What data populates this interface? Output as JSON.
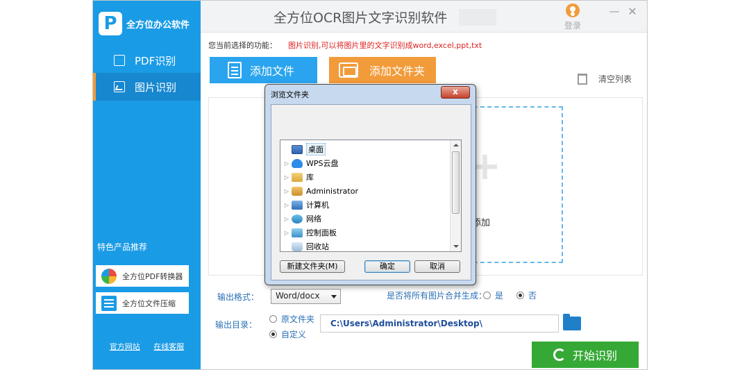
{
  "app": {
    "logo_letter": "P",
    "logo_text": "全方位办公软件",
    "title": "全方位OCR图片文字识别软件",
    "login_label": "登录",
    "minimize_glyph": "—",
    "close_glyph": "✕"
  },
  "sidebar": {
    "items": [
      {
        "label": "PDF识别",
        "icon": "pdf-doc-icon",
        "active": false
      },
      {
        "label": "图片识别",
        "icon": "image-icon",
        "active": true
      }
    ],
    "promo_title": "特色产品推荐",
    "promos": [
      {
        "label": "全方位PDF转换器",
        "icon": "pdf-converter-icon"
      },
      {
        "label": "全方位文件压缩",
        "icon": "file-compress-icon"
      }
    ],
    "footer_links": [
      "官方网站",
      "在线客服"
    ]
  },
  "main": {
    "function_label": "您当前选择的功能：",
    "function_value": "图片识别,可以将图片里的文字识别成word,excel,ppt,txt",
    "add_file_label": "添加文件",
    "add_folder_label": "添加文件夹",
    "clear_list_label": "清空列表",
    "drop_hint": "添加",
    "output_format_label": "输出格式：",
    "output_format_value": "Word/docx",
    "merge_label": "是否将所有图片合并生成：",
    "merge_yes": "是",
    "merge_no": "否",
    "merge_selected": "否",
    "output_dir_label": "输出目录：",
    "dir_original": "原文件夹",
    "dir_custom": "自定义",
    "dir_selected": "自定义",
    "output_path": "C:\\Users\\Administrator\\Desktop\\",
    "start_label": "开始识别"
  },
  "dialog": {
    "title": "浏览文件夹",
    "close_glyph": "x",
    "tree": [
      {
        "label": "桌面",
        "icon": "desktop-icon",
        "expandable": false,
        "selected": true
      },
      {
        "label": "WPS云盘",
        "icon": "cloud-icon",
        "expandable": true,
        "selected": false
      },
      {
        "label": "库",
        "icon": "library-icon",
        "expandable": true,
        "selected": false
      },
      {
        "label": "Administrator",
        "icon": "user-folder-icon",
        "expandable": true,
        "selected": false
      },
      {
        "label": "计算机",
        "icon": "computer-icon",
        "expandable": true,
        "selected": false
      },
      {
        "label": "网络",
        "icon": "network-icon",
        "expandable": true,
        "selected": false
      },
      {
        "label": "控制面板",
        "icon": "control-panel-icon",
        "expandable": true,
        "selected": false
      },
      {
        "label": "回收站",
        "icon": "recycle-bin-icon",
        "expandable": false,
        "selected": false
      }
    ],
    "new_folder_label": "新建文件夹(M)",
    "ok_label": "确定",
    "cancel_label": "取消"
  },
  "colors": {
    "sidebar": "#1a9be6",
    "accent_orange": "#f29b3a",
    "start_green": "#35a835",
    "function_red": "#e02020"
  }
}
